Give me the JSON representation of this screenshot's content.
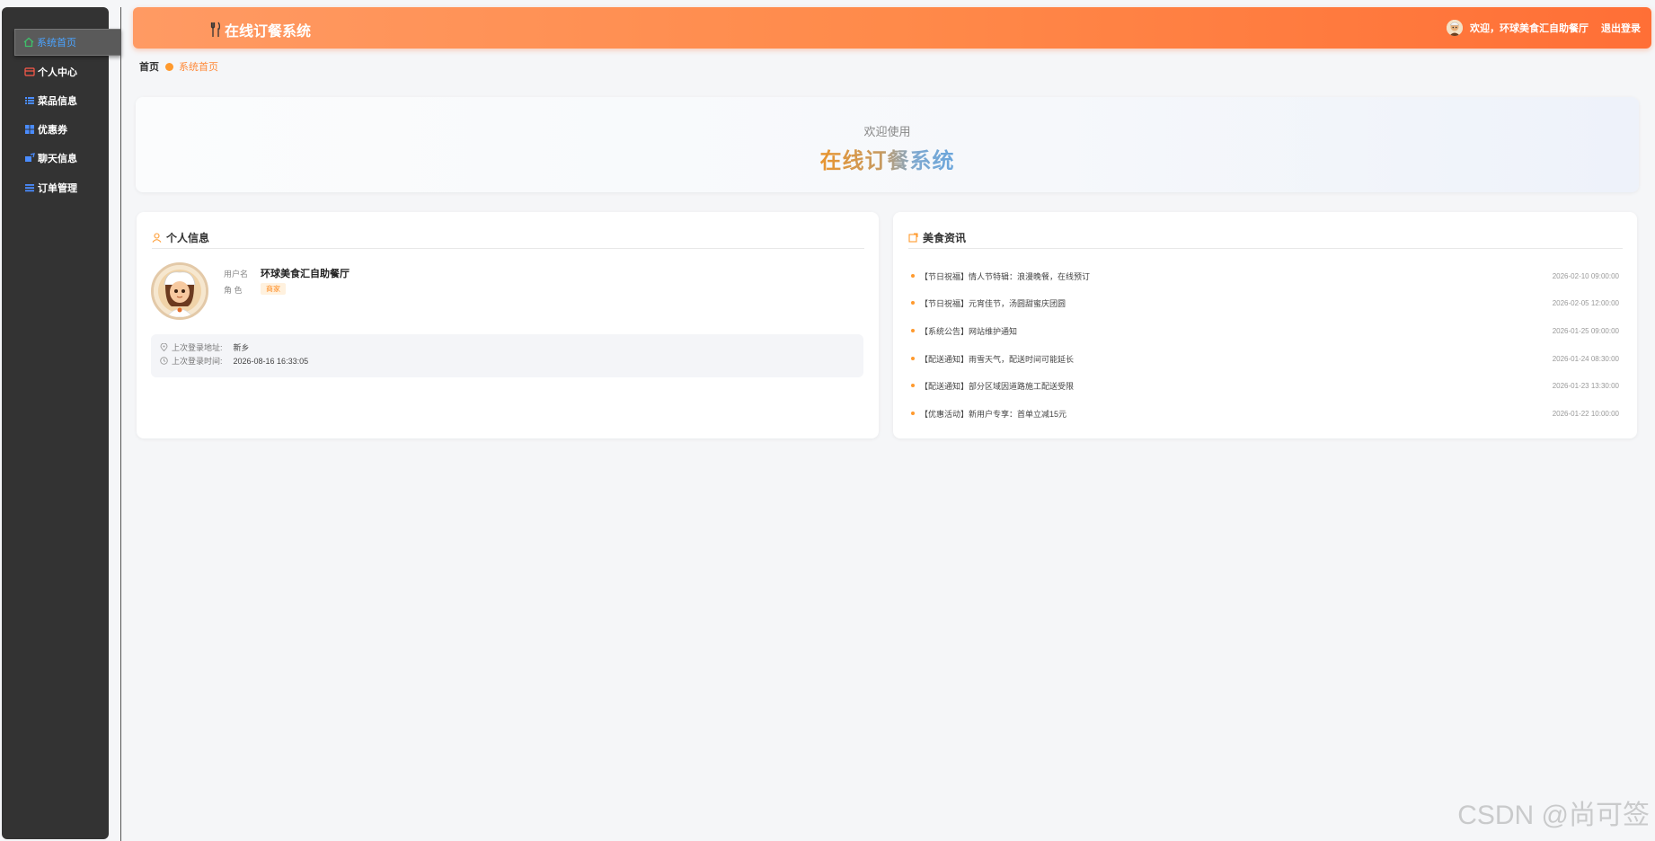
{
  "sidebar": {
    "items": [
      {
        "label": "系统首页",
        "icon": "home-icon",
        "active": true
      },
      {
        "label": "个人中心",
        "icon": "id-card-icon"
      },
      {
        "label": "菜品信息",
        "icon": "list-icon"
      },
      {
        "label": "优惠券",
        "icon": "grid-icon"
      },
      {
        "label": "聊天信息",
        "icon": "chat-icon"
      },
      {
        "label": "订单管理",
        "icon": "menu-icon"
      }
    ]
  },
  "header": {
    "title": "在线订餐系统",
    "greeting": "欢迎，环球美食汇自助餐厅",
    "logout": "退出登录"
  },
  "breadcrumb": {
    "home": "首页",
    "current": "系统首页"
  },
  "welcome": {
    "subtitle": "欢迎使用",
    "title": "在线订餐系统"
  },
  "profile": {
    "heading": "个人信息",
    "username_label": "用户名",
    "username": "环球美食汇自助餐厅",
    "role_label": "角 色",
    "role": "商家",
    "last_addr_label": "上次登录地址:",
    "last_addr": "新乡",
    "last_time_label": "上次登录时间:",
    "last_time": "2026-08-16 16:33:05"
  },
  "news": {
    "heading": "美食资讯",
    "items": [
      {
        "title": "【节日祝福】情人节特辑：浪漫晚餐，在线预订",
        "date": "2026-02-10 09:00:00"
      },
      {
        "title": "【节日祝福】元宵佳节，汤圆甜蜜庆团圆",
        "date": "2026-02-05 12:00:00"
      },
      {
        "title": "【系统公告】网站维护通知",
        "date": "2026-01-25 09:00:00"
      },
      {
        "title": "【配送通知】雨雪天气，配送时间可能延长",
        "date": "2026-01-24 08:30:00"
      },
      {
        "title": "【配送通知】部分区域因道路施工配送受限",
        "date": "2026-01-23 13:30:00"
      },
      {
        "title": "【优惠活动】新用户专享：首单立减15元",
        "date": "2026-01-22 10:00:00"
      }
    ]
  },
  "watermark": "CSDN @尚可签",
  "colors": {
    "accent": "#ff8a4a",
    "sidebar": "#333333",
    "active_text": "#4aa3ff"
  }
}
